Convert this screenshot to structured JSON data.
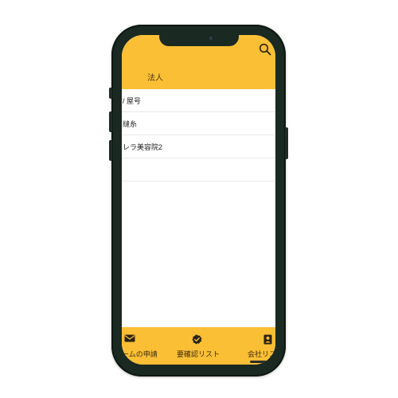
{
  "header": {
    "title": "法人",
    "search_icon": "search-icon",
    "color": "#fbbf35"
  },
  "list": {
    "items": [
      {
        "label": "/ 屋号"
      },
      {
        "label": "縫糸"
      },
      {
        "label": "レラ美容院2"
      },
      {
        "label": ""
      }
    ]
  },
  "tabbar": {
    "tabs": [
      {
        "label": "ームの申請",
        "icon": "envelope-icon"
      },
      {
        "label": "要確認リスト",
        "icon": "check-badge-icon"
      },
      {
        "label": "会社リス",
        "icon": "contact-card-icon"
      }
    ]
  }
}
